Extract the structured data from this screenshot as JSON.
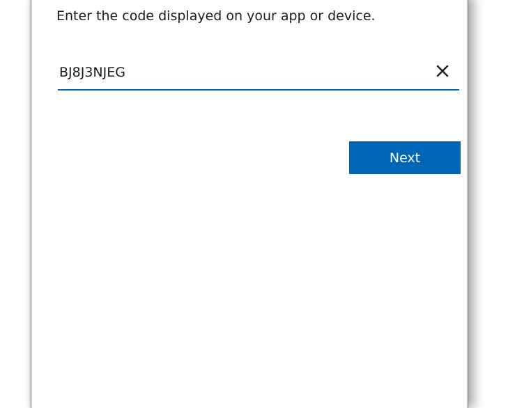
{
  "prompt": "Enter the code displayed on your app or device.",
  "code_input": {
    "value": "BJ8J3NJEG",
    "clear_icon": "close-icon"
  },
  "next_button": {
    "label": "Next",
    "color": "#0067b8"
  }
}
